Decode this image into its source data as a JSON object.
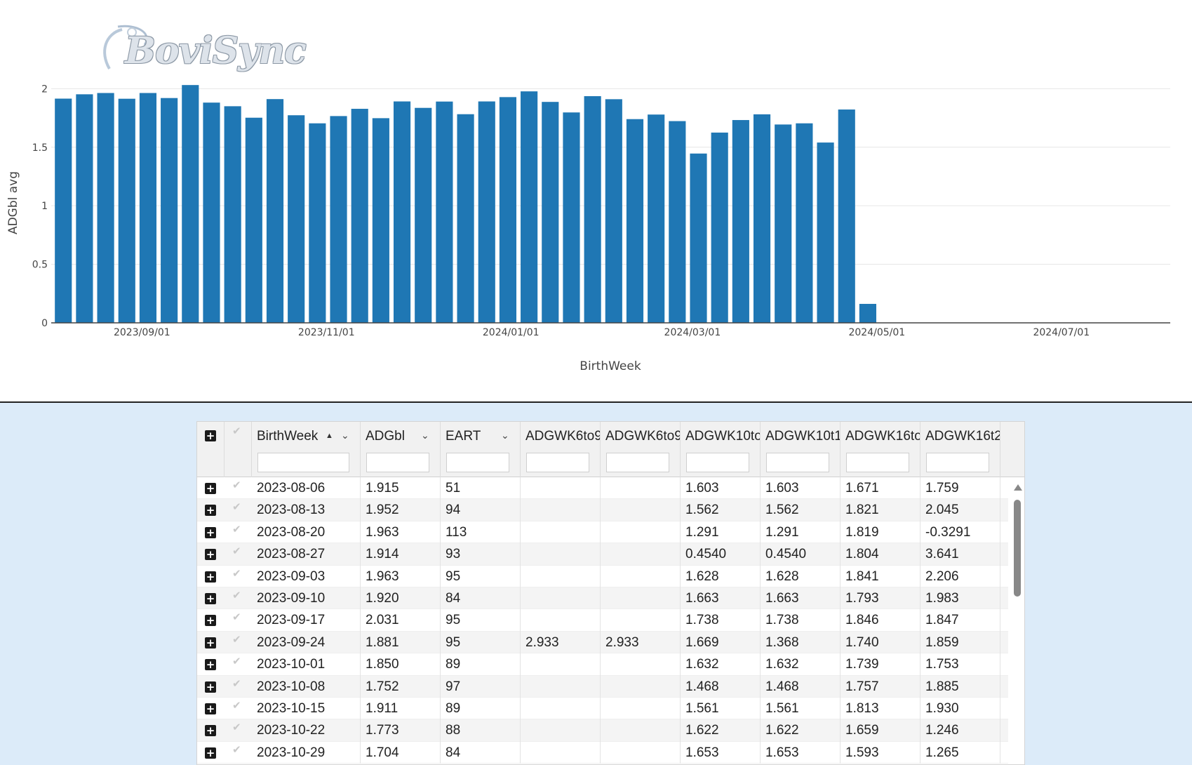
{
  "brand": {
    "logo_text": "BoviSync"
  },
  "chart_data": {
    "type": "bar",
    "title": "",
    "xlabel": "BirthWeek",
    "ylabel": "ADGbl avg",
    "ylim": [
      0,
      2.05
    ],
    "yticks": [
      0,
      0.5,
      1,
      1.5,
      2
    ],
    "ytick_labels": [
      "0",
      "0.5",
      "1",
      "1.5",
      "2"
    ],
    "xtick_labels": [
      "2023/09/01",
      "2023/11/01",
      "2024/01/01",
      "2024/03/01",
      "2024/05/01",
      "2024/07/01"
    ],
    "xticks": [
      "2023-09-01",
      "2023-11-01",
      "2024-01-01",
      "2024-03-01",
      "2024-05-01",
      "2024-07-01"
    ],
    "xrange": [
      "2023-08-02",
      "2024-08-06"
    ],
    "grid": true,
    "bar_color": "#1f77b4",
    "x": [
      "2023-08-06",
      "2023-08-13",
      "2023-08-20",
      "2023-08-27",
      "2023-09-03",
      "2023-09-10",
      "2023-09-17",
      "2023-09-24",
      "2023-10-01",
      "2023-10-08",
      "2023-10-15",
      "2023-10-22",
      "2023-10-29",
      "2023-11-05",
      "2023-11-12",
      "2023-11-19",
      "2023-11-26",
      "2023-12-03",
      "2023-12-10",
      "2023-12-17",
      "2023-12-24",
      "2023-12-31",
      "2024-01-07",
      "2024-01-14",
      "2024-01-21",
      "2024-01-28",
      "2024-02-04",
      "2024-02-11",
      "2024-02-18",
      "2024-02-25",
      "2024-03-03",
      "2024-03-10",
      "2024-03-17",
      "2024-03-24",
      "2024-03-31",
      "2024-04-07",
      "2024-04-14",
      "2024-04-21",
      "2024-04-28"
    ],
    "values": [
      1.915,
      1.952,
      1.963,
      1.914,
      1.963,
      1.92,
      2.031,
      1.881,
      1.85,
      1.752,
      1.911,
      1.773,
      1.704,
      1.766,
      1.828,
      1.748,
      1.891,
      1.836,
      1.89,
      1.782,
      1.891,
      1.928,
      1.977,
      1.887,
      1.797,
      1.936,
      1.91,
      1.74,
      1.779,
      1.723,
      1.446,
      1.625,
      1.732,
      1.781,
      1.694,
      1.704,
      1.54,
      1.822,
      0.162
    ]
  },
  "grid": {
    "columns": [
      {
        "key": "birthweek",
        "label": "BirthWeek",
        "sorted": "asc"
      },
      {
        "key": "adgbl",
        "label": "ADGbl"
      },
      {
        "key": "eart",
        "label": "EART"
      },
      {
        "key": "adgwk6to9a",
        "label": "ADGWK6to9"
      },
      {
        "key": "adgwk6to9b",
        "label": "ADGWK6to9"
      },
      {
        "key": "adgwk10to",
        "label": "ADGWK10to"
      },
      {
        "key": "adgwk10t1",
        "label": "ADGWK10t1!"
      },
      {
        "key": "adgwk16to",
        "label": "ADGWK16to:"
      },
      {
        "key": "adgwk16t2",
        "label": "ADGWK16t2!"
      }
    ],
    "rows": [
      [
        "2023-08-06",
        "1.915",
        "51",
        "",
        "",
        "1.603",
        "1.603",
        "1.671",
        "1.759"
      ],
      [
        "2023-08-13",
        "1.952",
        "94",
        "",
        "",
        "1.562",
        "1.562",
        "1.821",
        "2.045"
      ],
      [
        "2023-08-20",
        "1.963",
        "113",
        "",
        "",
        "1.291",
        "1.291",
        "1.819",
        "-0.3291"
      ],
      [
        "2023-08-27",
        "1.914",
        "93",
        "",
        "",
        "0.4540",
        "0.4540",
        "1.804",
        "3.641"
      ],
      [
        "2023-09-03",
        "1.963",
        "95",
        "",
        "",
        "1.628",
        "1.628",
        "1.841",
        "2.206"
      ],
      [
        "2023-09-10",
        "1.920",
        "84",
        "",
        "",
        "1.663",
        "1.663",
        "1.793",
        "1.983"
      ],
      [
        "2023-09-17",
        "2.031",
        "95",
        "",
        "",
        "1.738",
        "1.738",
        "1.846",
        "1.847"
      ],
      [
        "2023-09-24",
        "1.881",
        "95",
        "2.933",
        "2.933",
        "1.669",
        "1.368",
        "1.740",
        "1.859"
      ],
      [
        "2023-10-01",
        "1.850",
        "89",
        "",
        "",
        "1.632",
        "1.632",
        "1.739",
        "1.753"
      ],
      [
        "2023-10-08",
        "1.752",
        "97",
        "",
        "",
        "1.468",
        "1.468",
        "1.757",
        "1.885"
      ],
      [
        "2023-10-15",
        "1.911",
        "89",
        "",
        "",
        "1.561",
        "1.561",
        "1.813",
        "1.930"
      ],
      [
        "2023-10-22",
        "1.773",
        "88",
        "",
        "",
        "1.622",
        "1.622",
        "1.659",
        "1.246"
      ],
      [
        "2023-10-29",
        "1.704",
        "84",
        "",
        "",
        "1.653",
        "1.653",
        "1.593",
        "1.265"
      ]
    ]
  },
  "icons": {
    "expand": "plus-square-icon",
    "check": "check-icon",
    "sort": "sort-asc-icon",
    "menu": "chevron-down-icon"
  }
}
